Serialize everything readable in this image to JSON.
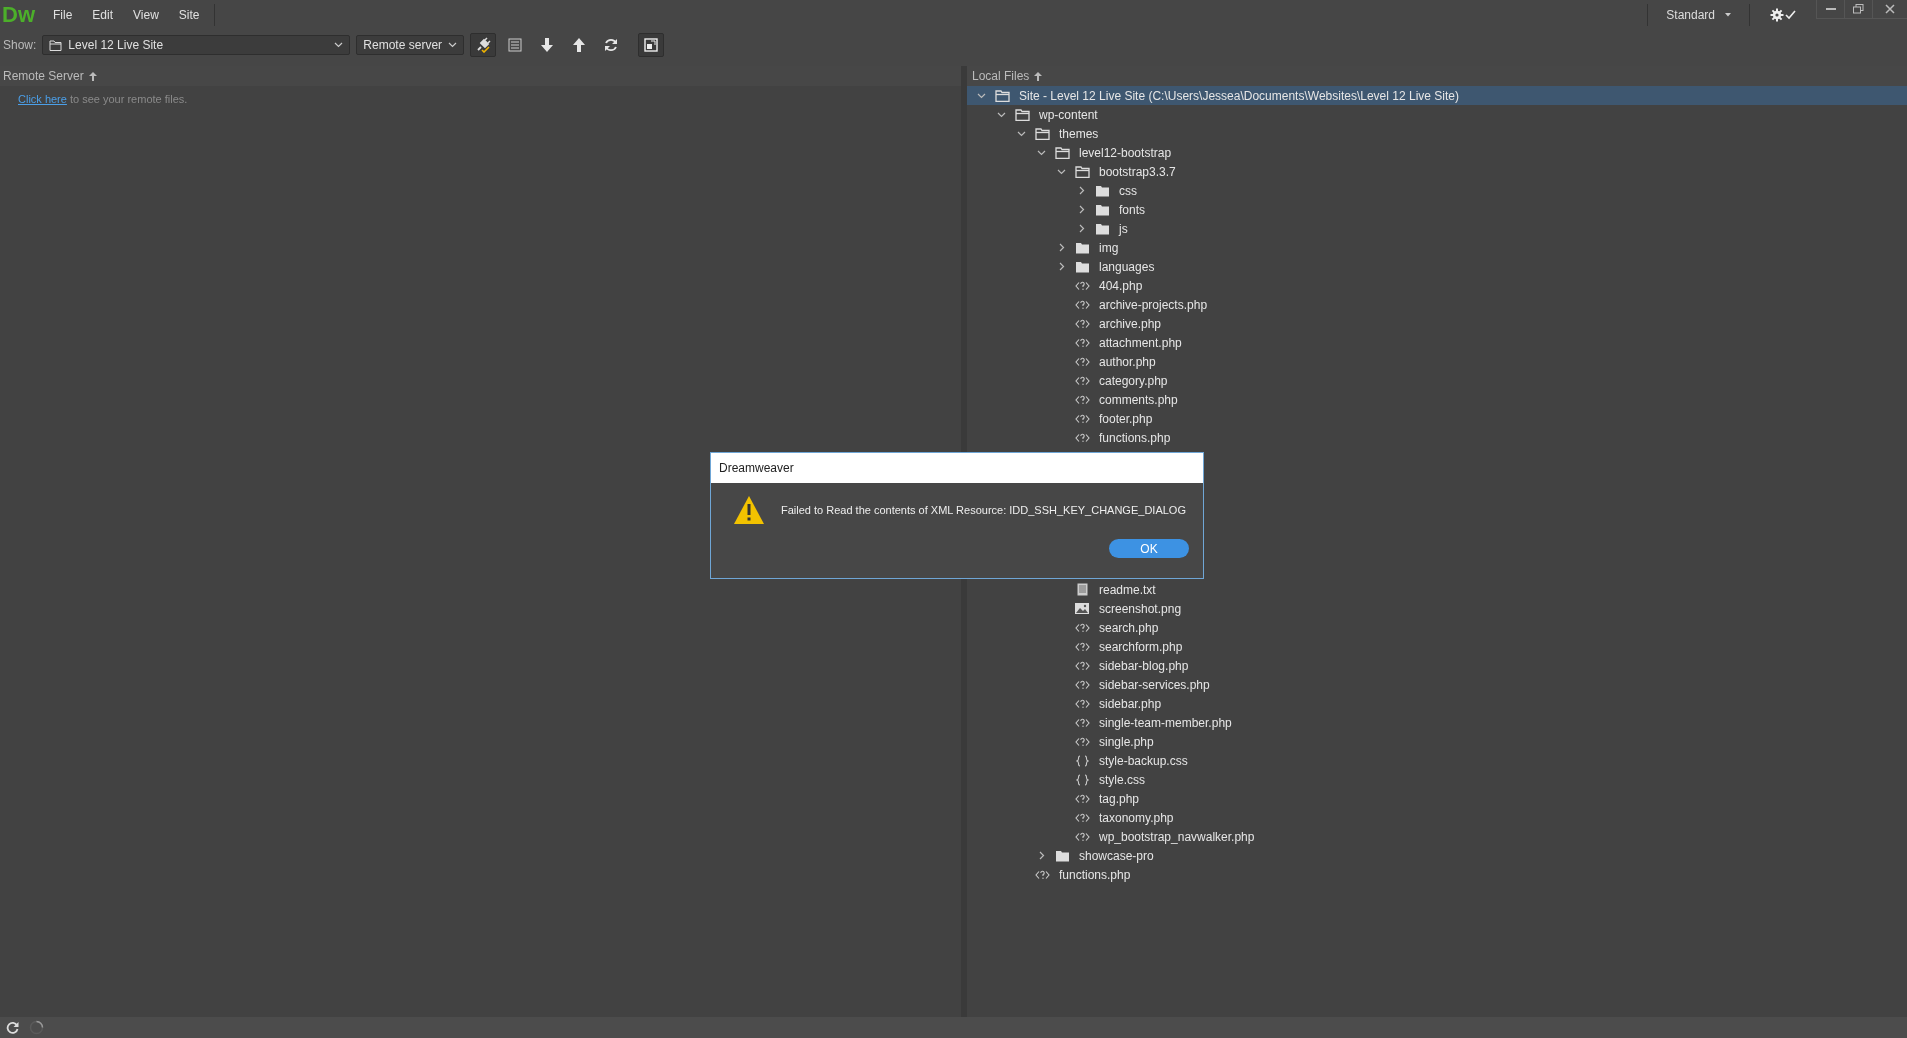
{
  "app": {
    "logo": "Dw",
    "menu": [
      "File",
      "Edit",
      "View",
      "Site"
    ],
    "workspace": "Standard"
  },
  "toolbar": {
    "show_label": "Show:",
    "site": "Level 12 Live Site",
    "server_view": "Remote server"
  },
  "remote_panel": {
    "header": "Remote Server",
    "link": "Click here",
    "message": " to see your remote files."
  },
  "local_panel": {
    "header": "Local Files",
    "tree": [
      {
        "name": "Site - Level 12 Live Site (C:\\Users\\Jessea\\Documents\\Websites\\Level 12 Live Site)",
        "kind": "folder",
        "expanded": true,
        "selected": true,
        "children": [
          {
            "name": "wp-content",
            "kind": "folder",
            "expanded": true,
            "selected": false,
            "children": [
              {
                "name": "themes",
                "kind": "folder",
                "expanded": true,
                "selected": false,
                "children": [
                  {
                    "name": "level12-bootstrap",
                    "kind": "folder",
                    "expanded": true,
                    "selected": false,
                    "children": [
                      {
                        "name": "bootstrap3.3.7",
                        "kind": "folder",
                        "expanded": true,
                        "selected": false,
                        "children": [
                          {
                            "name": "css",
                            "kind": "folder",
                            "expanded": false,
                            "selected": false
                          },
                          {
                            "name": "fonts",
                            "kind": "folder",
                            "expanded": false,
                            "selected": false
                          },
                          {
                            "name": "js",
                            "kind": "folder",
                            "expanded": false,
                            "selected": false
                          }
                        ]
                      },
                      {
                        "name": "img",
                        "kind": "folder",
                        "expanded": false,
                        "selected": false
                      },
                      {
                        "name": "languages",
                        "kind": "folder",
                        "expanded": false,
                        "selected": false
                      },
                      {
                        "name": "404.php",
                        "kind": "php",
                        "selected": false
                      },
                      {
                        "name": "archive-projects.php",
                        "kind": "php",
                        "selected": false
                      },
                      {
                        "name": "archive.php",
                        "kind": "php",
                        "selected": false
                      },
                      {
                        "name": "attachment.php",
                        "kind": "php",
                        "selected": false
                      },
                      {
                        "name": "author.php",
                        "kind": "php",
                        "selected": false
                      },
                      {
                        "name": "category.php",
                        "kind": "php",
                        "selected": false
                      },
                      {
                        "name": "comments.php",
                        "kind": "php",
                        "selected": false
                      },
                      {
                        "name": "footer.php",
                        "kind": "php",
                        "selected": false
                      },
                      {
                        "name": "functions.php",
                        "kind": "php",
                        "selected": false
                      },
                      {
                        "name": "readme.txt",
                        "kind": "text",
                        "selected": false
                      },
                      {
                        "name": "screenshot.png",
                        "kind": "image",
                        "selected": false
                      },
                      {
                        "name": "search.php",
                        "kind": "php",
                        "selected": false
                      },
                      {
                        "name": "searchform.php",
                        "kind": "php",
                        "selected": false
                      },
                      {
                        "name": "sidebar-blog.php",
                        "kind": "php",
                        "selected": false
                      },
                      {
                        "name": "sidebar-services.php",
                        "kind": "php",
                        "selected": false
                      },
                      {
                        "name": "sidebar.php",
                        "kind": "php",
                        "selected": false
                      },
                      {
                        "name": "single-team-member.php",
                        "kind": "php",
                        "selected": false
                      },
                      {
                        "name": "single.php",
                        "kind": "php",
                        "selected": false
                      },
                      {
                        "name": "style-backup.css",
                        "kind": "css",
                        "selected": false
                      },
                      {
                        "name": "style.css",
                        "kind": "css",
                        "selected": false
                      },
                      {
                        "name": "tag.php",
                        "kind": "php",
                        "selected": false
                      },
                      {
                        "name": "taxonomy.php",
                        "kind": "php",
                        "selected": false
                      },
                      {
                        "name": "wp_bootstrap_navwalker.php",
                        "kind": "php",
                        "selected": false
                      }
                    ]
                  },
                  {
                    "name": "showcase-pro",
                    "kind": "folder",
                    "expanded": false,
                    "selected": false
                  }
                ]
              },
              {
                "name": "functions.php",
                "kind": "php",
                "selected": false
              }
            ]
          }
        ]
      }
    ]
  },
  "dialog": {
    "title": "Dreamweaver",
    "message": "Failed to Read the contents of XML Resource: IDD_SSH_KEY_CHANGE_DIALOG",
    "button": "OK"
  }
}
